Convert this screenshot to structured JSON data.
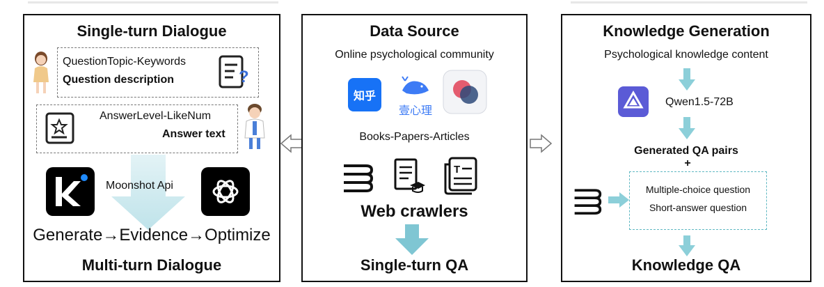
{
  "left": {
    "title": "Single-turn Dialogue",
    "question_meta": "QuestionTopic-Keywords",
    "question_desc": "Question description",
    "answer_meta": "AnswerLevel-LikeNum",
    "answer_text": "Answer text",
    "api_label": "Moonshot Api",
    "pipeline": "Generate→Evidence→Optimize",
    "bottom_title": "Multi-turn Dialogue"
  },
  "middle": {
    "title": "Data Source",
    "online_label": "Online psychological community",
    "logo_zhihu": "知乎",
    "logo_xinli": "壹心理",
    "books_label": "Books-Papers-Articles",
    "crawler_label": "Web crawlers",
    "bottom_title": "Single-turn QA"
  },
  "right": {
    "title": "Knowledge Generation",
    "content_label": "Psychological knowledge content",
    "model_label": "Qwen1.5-72B",
    "generated_label": "Generated QA pairs",
    "plus": "+",
    "mcq": "Multiple-choice question",
    "saq": "Short-answer question",
    "bottom_title": "Knowledge QA"
  },
  "colors": {
    "arrow_fill": "#bfe3ea",
    "arrow_light": "#e3f3f6",
    "teal_dash": "#5fb8c2",
    "zhihu_blue": "#1772f6",
    "whale_blue": "#3d7bf5",
    "qwen_purple": "#5b5bd6"
  }
}
